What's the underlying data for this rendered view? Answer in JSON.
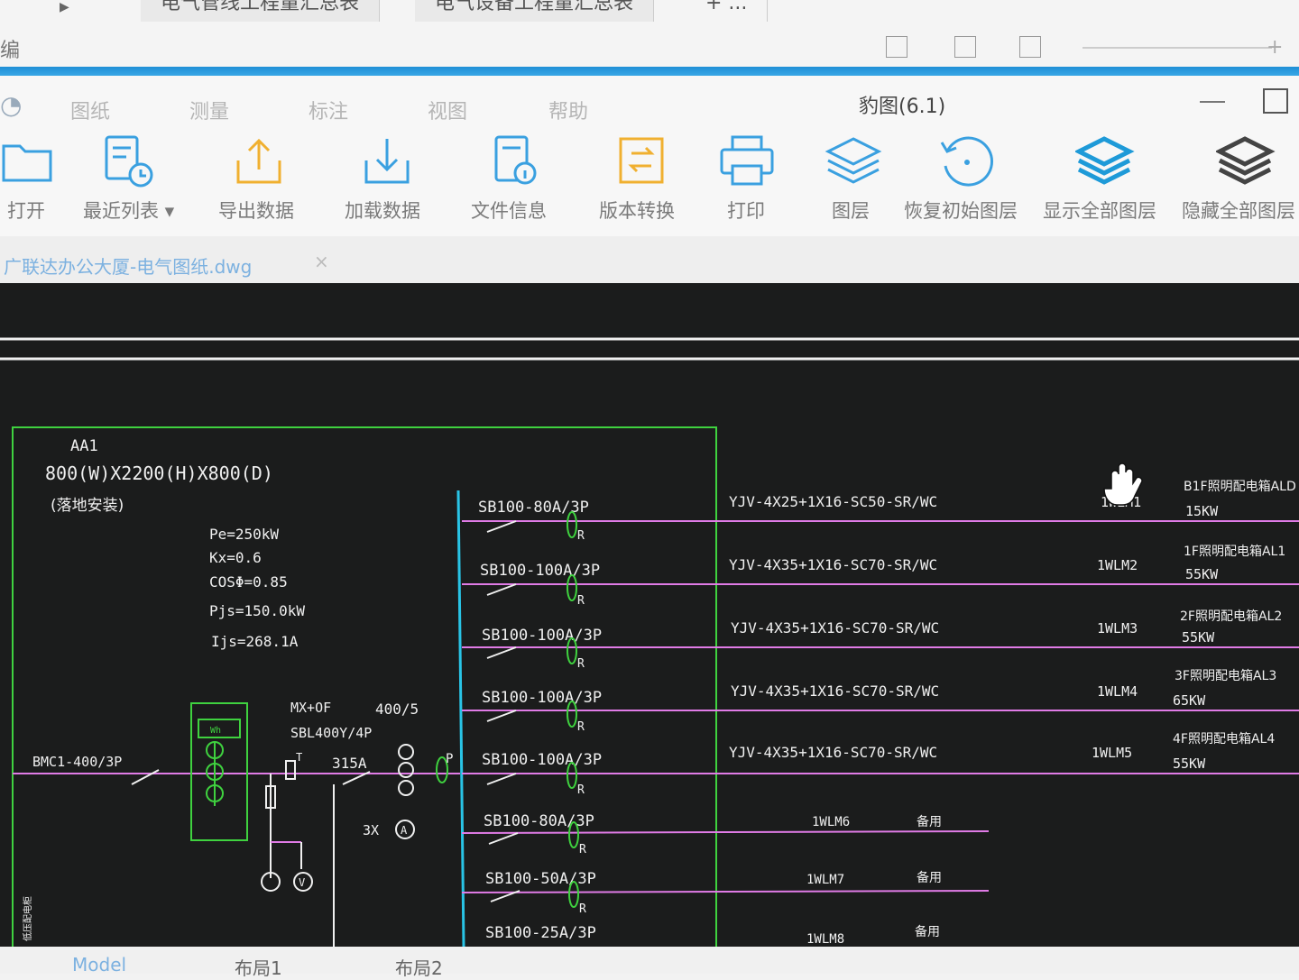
{
  "top_strip": {
    "tab1": "电气管线工程量汇总表",
    "tab2": "电气设备工程量汇总表",
    "tab3": "+ ...",
    "edit_label": "编"
  },
  "app": {
    "title": "豹图(6.1)",
    "menu": [
      "图纸",
      "测量",
      "标注",
      "视图",
      "帮助"
    ]
  },
  "toolbar": {
    "open": "打开",
    "recent": "最近列表",
    "export": "导出数据",
    "load": "加载数据",
    "fileinfo": "文件信息",
    "convert": "版本转换",
    "print": "打印",
    "layer": "图层",
    "restore_layer": "恢复初始图层",
    "show_all": "显示全部图层",
    "hide_all": "隐藏全部图层"
  },
  "file_tab": {
    "name": "广联达办公大厦-电气图纸.dwg",
    "close": "×"
  },
  "drawing": {
    "panel_id": "AA1",
    "dims": "800(W)X2200(H)X800(D)",
    "mount": "(落地安装)",
    "params": [
      "Pe=250kW",
      "Kx=0.6",
      "COSΦ=0.85",
      "Pjs=150.0kW",
      "Ijs=268.1A"
    ],
    "incoming": "BMC1-400/3P",
    "mx": "MX+OF",
    "ct": "400/5",
    "sbl": "SBL400Y/4P",
    "fuse": "315A",
    "ammeter": "3X",
    "wh": "Wh",
    "a_sym": "A",
    "v_sym": "V",
    "t_label": "T",
    "p_label": "P",
    "r_label": "R",
    "side_label": "低压配电柜",
    "circuits": [
      {
        "breaker": "SB100-80A/3P",
        "cable": "YJV-4X25+1X16-SC50-SR/WC",
        "id": "1WLM1",
        "dest": "B1F照明配电箱ALD",
        "power": "15KW"
      },
      {
        "breaker": "SB100-100A/3P",
        "cable": "YJV-4X35+1X16-SC70-SR/WC",
        "id": "1WLM2",
        "dest": "1F照明配电箱AL1",
        "power": "55KW"
      },
      {
        "breaker": "SB100-100A/3P",
        "cable": "YJV-4X35+1X16-SC70-SR/WC",
        "id": "1WLM3",
        "dest": "2F照明配电箱AL2",
        "power": "55KW"
      },
      {
        "breaker": "SB100-100A/3P",
        "cable": "YJV-4X35+1X16-SC70-SR/WC",
        "id": "1WLM4",
        "dest": "3F照明配电箱AL3",
        "power": "65KW"
      },
      {
        "breaker": "SB100-100A/3P",
        "cable": "YJV-4X35+1X16-SC70-SR/WC",
        "id": "1WLM5",
        "dest": "4F照明配电箱AL4",
        "power": "55KW"
      },
      {
        "breaker": "SB100-80A/3P",
        "cable": "",
        "id": "1WLM6",
        "dest": "备用",
        "power": ""
      },
      {
        "breaker": "SB100-50A/3P",
        "cable": "",
        "id": "1WLM7",
        "dest": "备用",
        "power": ""
      },
      {
        "breaker": "SB100-25A/3P",
        "cable": "",
        "id": "1WLM8",
        "dest": "备用",
        "power": ""
      }
    ]
  },
  "bottom_tabs": [
    "Model",
    "布局1",
    "布局2"
  ],
  "colors": {
    "canvas_bg": "#1b1c1c",
    "panel_green": "#3fd23f",
    "feeder_magenta": "#e07be6",
    "bus_cyan": "#29c4e6",
    "text_white": "#f0f0f0"
  }
}
